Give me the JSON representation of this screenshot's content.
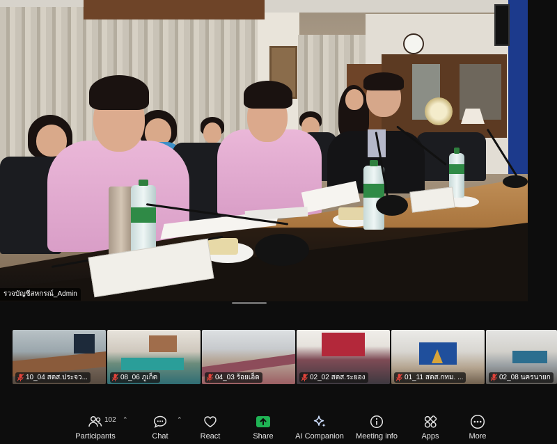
{
  "main_video": {
    "speaker_name": "รวจบัญชีสหกรณ์_Admin"
  },
  "gallery": [
    {
      "name": "10_04 สตส.ประจว..."
    },
    {
      "name": "08_06 ภูเก็ต"
    },
    {
      "name": "04_03 ร้อยเอ็ด"
    },
    {
      "name": "02_02 สตส.ระยอง"
    },
    {
      "name": "01_11 สตส.กทม. ..."
    },
    {
      "name": "02_08 นครนายก"
    }
  ],
  "toolbar": {
    "participants_label": "Participants",
    "participants_count": "102",
    "chat_label": "Chat",
    "react_label": "React",
    "share_label": "Share",
    "ai_label": "AI Companion",
    "meeting_info_label": "Meeting info",
    "apps_label": "Apps",
    "more_label": "More"
  },
  "colors": {
    "share_green": "#1fb354",
    "muted_red": "#e0433a",
    "toolbar_bg": "#0d0d0d"
  }
}
